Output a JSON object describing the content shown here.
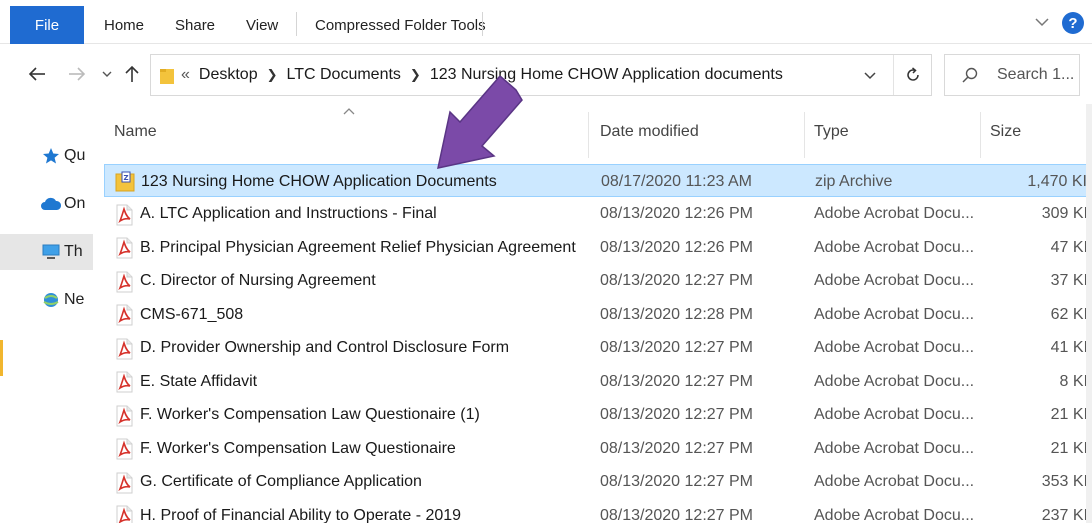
{
  "ribbon": {
    "file_tab": "File",
    "tabs": [
      "Home",
      "Share",
      "View",
      "Compressed Folder Tools"
    ],
    "help": "?"
  },
  "nav": {
    "crumb_prefix": "«",
    "crumbs": [
      "Desktop",
      "LTC Documents",
      "123 Nursing Home CHOW Application documents"
    ],
    "search_placeholder": "Search 1..."
  },
  "navpane": {
    "items": [
      "Qu",
      "On",
      "Th",
      "Ne"
    ]
  },
  "columns": {
    "name": "Name",
    "date": "Date modified",
    "type": "Type",
    "size": "Size"
  },
  "files": [
    {
      "name": "123 Nursing Home CHOW Application Documents",
      "date": "08/17/2020 11:23 AM",
      "type": "zip Archive",
      "size": "1,470 KI",
      "icon": "zip-icon",
      "selected": true
    },
    {
      "name": "A. LTC Application and Instructions - Final",
      "date": "08/13/2020 12:26 PM",
      "type": "Adobe Acrobat Docu...",
      "size": "309 KI",
      "icon": "pdf-icon"
    },
    {
      "name": "B. Principal Physician Agreement Relief Physician Agreement",
      "date": "08/13/2020 12:26 PM",
      "type": "Adobe Acrobat Docu...",
      "size": "47 KI",
      "icon": "pdf-icon"
    },
    {
      "name": "C. Director of Nursing Agreement",
      "date": "08/13/2020 12:27 PM",
      "type": "Adobe Acrobat Docu...",
      "size": "37 KI",
      "icon": "pdf-icon"
    },
    {
      "name": "CMS-671_508",
      "date": "08/13/2020 12:28 PM",
      "type": "Adobe Acrobat Docu...",
      "size": "62 KI",
      "icon": "pdf-icon"
    },
    {
      "name": "D. Provider Ownership and Control Disclosure Form",
      "date": "08/13/2020 12:27 PM",
      "type": "Adobe Acrobat Docu...",
      "size": "41 KI",
      "icon": "pdf-icon"
    },
    {
      "name": "E. State Affidavit",
      "date": "08/13/2020 12:27 PM",
      "type": "Adobe Acrobat Docu...",
      "size": "8 KI",
      "icon": "pdf-icon"
    },
    {
      "name": "F. Worker's Compensation Law Questionaire (1)",
      "date": "08/13/2020 12:27 PM",
      "type": "Adobe Acrobat Docu...",
      "size": "21 KI",
      "icon": "pdf-icon"
    },
    {
      "name": "F. Worker's Compensation Law Questionaire",
      "date": "08/13/2020 12:27 PM",
      "type": "Adobe Acrobat Docu...",
      "size": "21 KI",
      "icon": "pdf-icon"
    },
    {
      "name": "G. Certificate of Compliance Application",
      "date": "08/13/2020 12:27 PM",
      "type": "Adobe Acrobat Docu...",
      "size": "353 KI",
      "icon": "pdf-icon"
    },
    {
      "name": "H. Proof of Financial Ability to Operate - 2019",
      "date": "08/13/2020 12:27 PM",
      "type": "Adobe Acrobat Docu...",
      "size": "237 KI",
      "icon": "pdf-icon"
    }
  ],
  "colors": {
    "accent": "#1f6bd1",
    "selection": "#cce8ff",
    "annotation_arrow": "#7b4aa8",
    "pdf_red": "#d6322b",
    "folder_yellow": "#f3c33c"
  }
}
